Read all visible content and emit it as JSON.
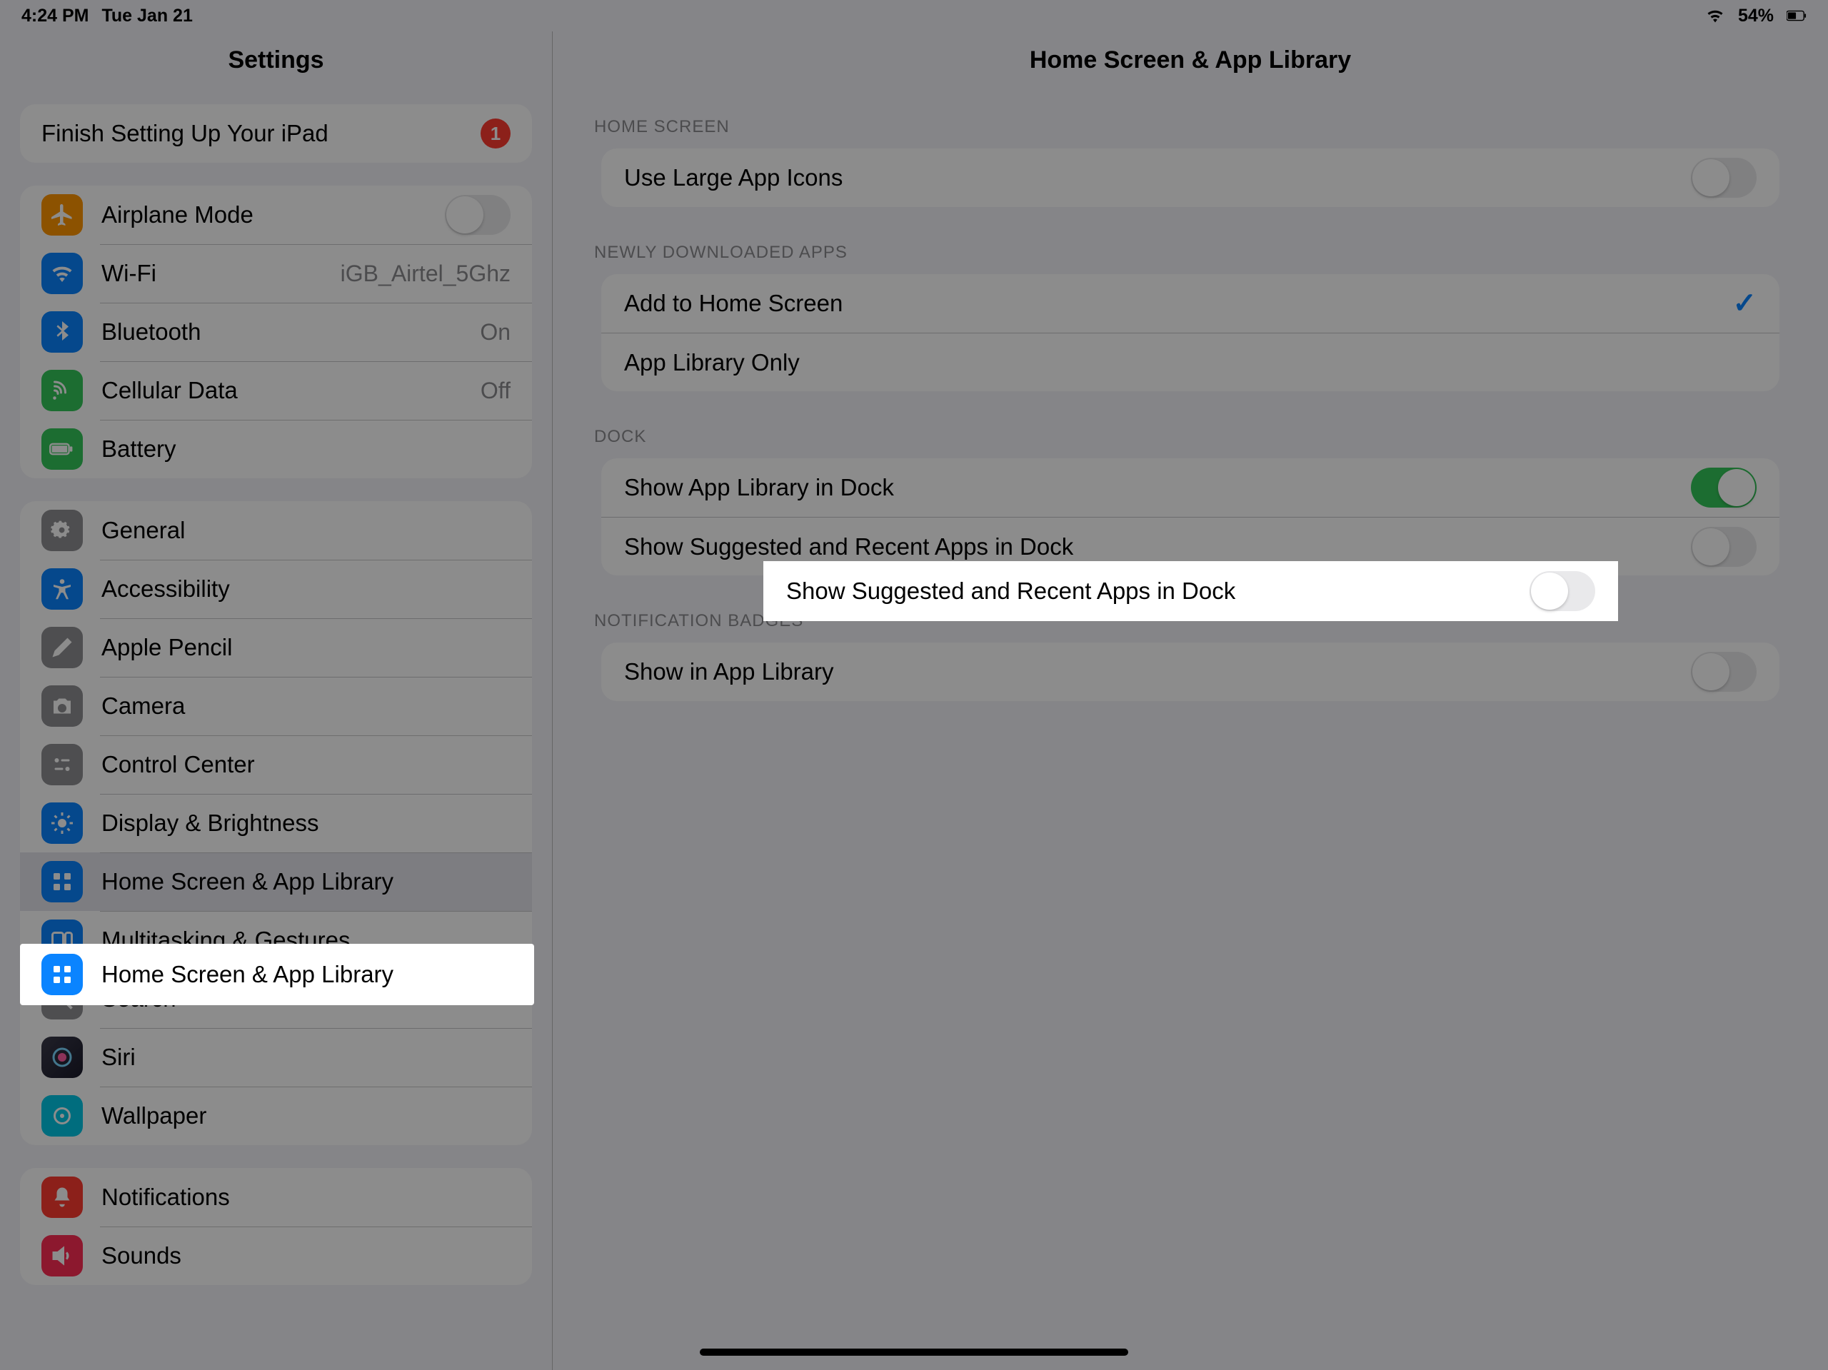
{
  "status": {
    "time": "4:24 PM",
    "date": "Tue Jan 21",
    "battery_pct": "54%"
  },
  "sidebar": {
    "title": "Settings",
    "setup": {
      "label": "Finish Setting Up Your iPad",
      "badge": "1"
    },
    "network": {
      "airplane": "Airplane Mode",
      "wifi": "Wi-Fi",
      "wifi_value": "iGB_Airtel_5Ghz",
      "bluetooth": "Bluetooth",
      "bluetooth_value": "On",
      "cellular": "Cellular Data",
      "cellular_value": "Off",
      "battery": "Battery"
    },
    "general_group": {
      "general": "General",
      "accessibility": "Accessibility",
      "pencil": "Apple Pencil",
      "camera": "Camera",
      "control_center": "Control Center",
      "display": "Display & Brightness",
      "home_screen": "Home Screen & App Library",
      "multitasking": "Multitasking & Gestures",
      "search": "Search",
      "siri": "Siri",
      "wallpaper": "Wallpaper"
    },
    "system_group": {
      "notifications": "Notifications",
      "sounds": "Sounds"
    }
  },
  "detail": {
    "title": "Home Screen & App Library",
    "home_screen_header": "HOME SCREEN",
    "large_icons": "Use Large App Icons",
    "newly_downloaded_header": "NEWLY DOWNLOADED APPS",
    "add_home": "Add to Home Screen",
    "app_lib_only": "App Library Only",
    "dock_header": "DOCK",
    "show_app_lib": "Show App Library in Dock",
    "show_suggested": "Show Suggested and Recent Apps in Dock",
    "notif_header": "NOTIFICATION BADGES",
    "show_in_lib": "Show in App Library"
  }
}
